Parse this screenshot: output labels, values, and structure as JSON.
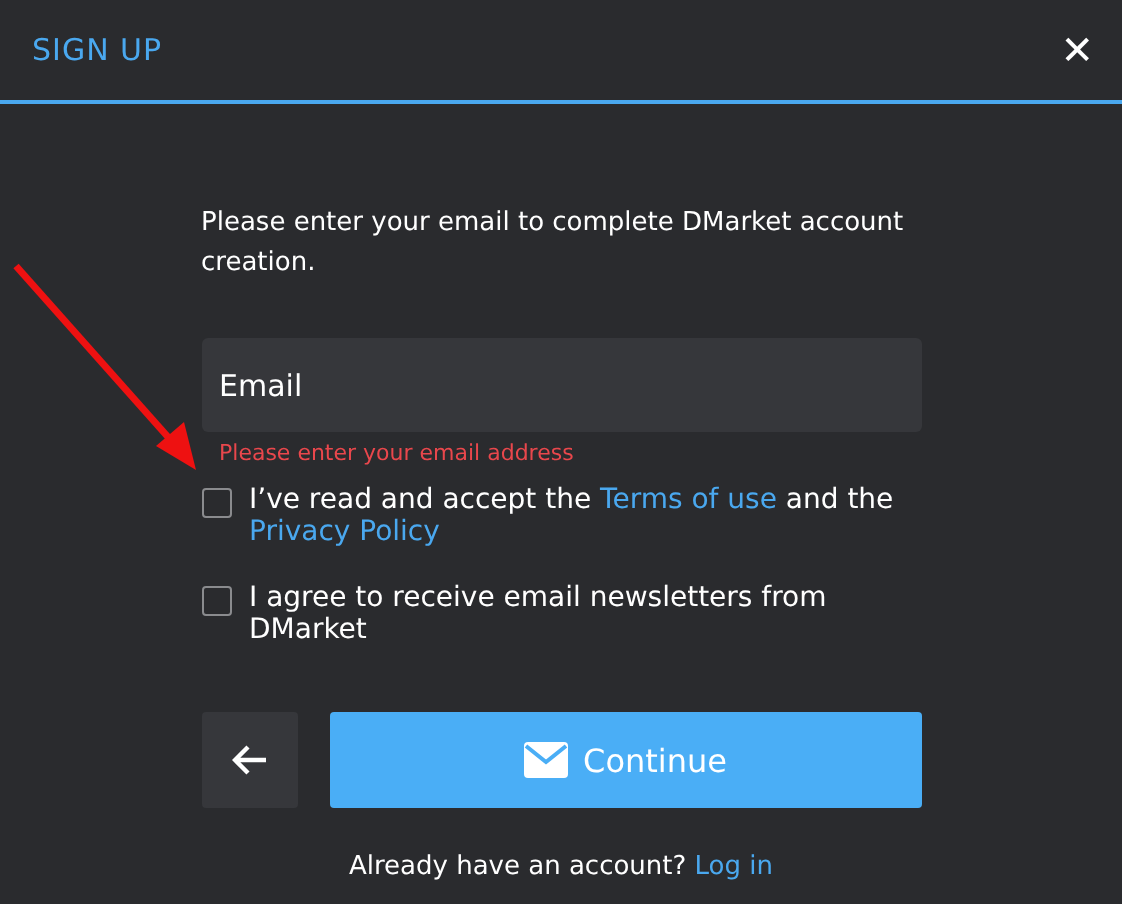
{
  "header": {
    "title": "SIGN UP",
    "close": "✕"
  },
  "intro": "Please enter your email to complete DMarket account creation.",
  "email": {
    "placeholder": "Email",
    "error": "Please enter your email address"
  },
  "agreements": [
    {
      "checked": false,
      "parts": [
        {
          "kind": "text",
          "text": "I’ve read and accept the"
        },
        {
          "kind": "link",
          "text": "Terms of use"
        },
        {
          "kind": "text",
          "text": "and the"
        },
        {
          "kind": "link",
          "text": "Privacy Policy"
        }
      ]
    },
    {
      "checked": false,
      "parts": [
        {
          "kind": "text",
          "text": "I agree to receive email newsletters from DMarket"
        }
      ]
    }
  ],
  "buttons": {
    "continue": "Continue"
  },
  "footer": {
    "question": "Already have an account?",
    "link": "Log in"
  },
  "annotation": {
    "kind": "arrow"
  }
}
